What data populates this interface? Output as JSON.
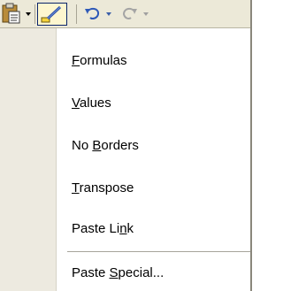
{
  "toolbar": {
    "paste_icon": "paste-clipboard-icon",
    "format_painter_icon": "format-painter-brush-icon",
    "undo_icon": "undo-icon",
    "redo_icon": "redo-icon",
    "dropdown_icon": "chevron-down-icon"
  },
  "menu": {
    "items": [
      {
        "pre": "",
        "key": "F",
        "post": "ormulas"
      },
      {
        "pre": "",
        "key": "V",
        "post": "alues"
      },
      {
        "pre": "No ",
        "key": "B",
        "post": "orders"
      },
      {
        "pre": "",
        "key": "T",
        "post": "ranspose"
      },
      {
        "pre": "Paste Li",
        "key": "n",
        "post": "k"
      },
      {
        "pre": "Paste ",
        "key": "S",
        "post": "pecial..."
      }
    ]
  },
  "colors": {
    "toolbar_bg": "#ece9d8",
    "gutter_bg": "#edeae0",
    "highlight_border": "#0a246a"
  }
}
